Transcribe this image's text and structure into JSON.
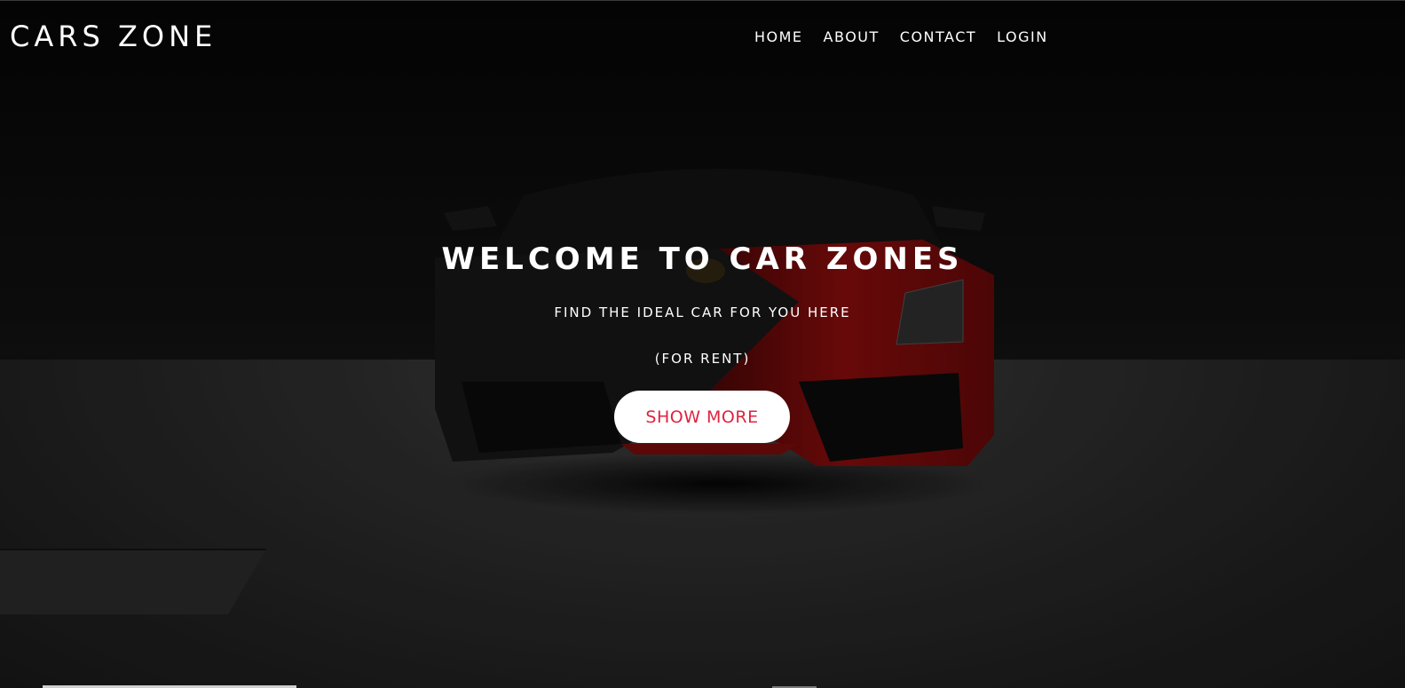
{
  "header": {
    "brand": "CARS ZONE",
    "nav": [
      {
        "label": "HOME"
      },
      {
        "label": "ABOUT"
      },
      {
        "label": "CONTACT"
      },
      {
        "label": "LOGIN"
      }
    ]
  },
  "hero": {
    "title": "WELCOME TO CAR ZONES",
    "subtitle": "FIND THE IDEAL CAR FOR YOU HERE",
    "note": "(FOR RENT)",
    "cta_label": "SHOW MORE"
  },
  "colors": {
    "accent": "#e0233f",
    "text": "#ffffff",
    "background": "#070707",
    "car_red": "#8a0d0d"
  }
}
